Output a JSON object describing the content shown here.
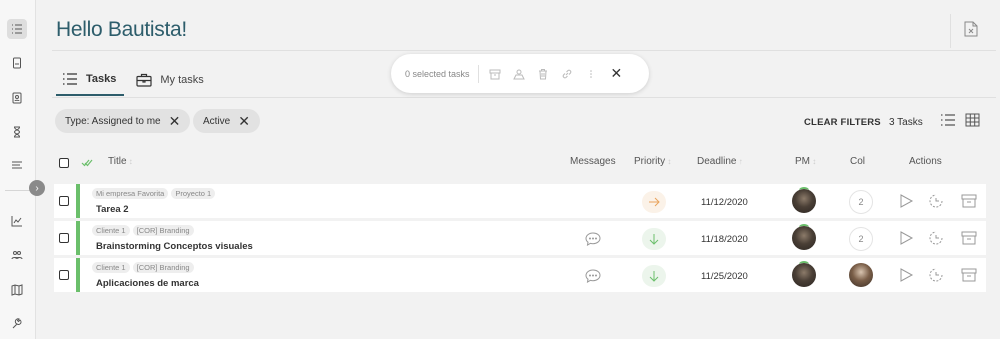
{
  "header": {
    "greeting": "Hello Bautista!"
  },
  "tabs": [
    {
      "label": "Tasks",
      "icon": "list-icon",
      "active": true
    },
    {
      "label": "My tasks",
      "icon": "briefcase-icon",
      "active": false
    }
  ],
  "selection_bar": {
    "text": "0 selected tasks",
    "close": "✕"
  },
  "filters": [
    {
      "label": "Type: Assigned to me"
    },
    {
      "label": "Active"
    }
  ],
  "toolbar": {
    "clear_filters": "CLEAR FILTERS",
    "task_count": "3 Tasks"
  },
  "columns": {
    "title": "Title",
    "messages": "Messages",
    "priority": "Priority",
    "deadline": "Deadline",
    "pm": "PM",
    "col": "Col",
    "actions": "Actions"
  },
  "rows": [
    {
      "tags": [
        "Mi empresa Favorita",
        "Proyecto 1"
      ],
      "title": "Tarea 2",
      "has_messages": false,
      "priority": "medium",
      "deadline": "11/12/2020",
      "col_count": "2",
      "col_avatar": false
    },
    {
      "tags": [
        "Cliente 1",
        "[COR] Branding"
      ],
      "title": "Brainstorming Conceptos visuales",
      "has_messages": true,
      "priority": "low",
      "deadline": "11/18/2020",
      "col_count": "2",
      "col_avatar": false
    },
    {
      "tags": [
        "Cliente 1",
        "[COR] Branding"
      ],
      "title": "Aplicaciones de marca",
      "has_messages": true,
      "priority": "low",
      "deadline": "11/25/2020",
      "col_count": "",
      "col_avatar": true
    }
  ],
  "colors": {
    "title": "#2d5d6b",
    "status_bar": "#6bbf6b",
    "priority_low": "#6bbf6b",
    "priority_medium": "#e8a35c"
  }
}
